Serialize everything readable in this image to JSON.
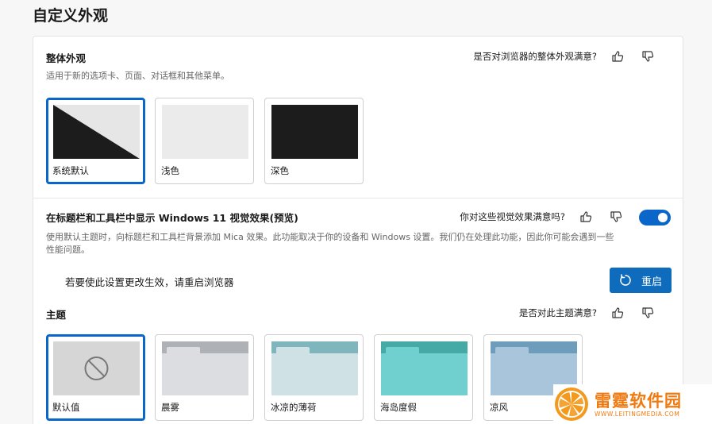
{
  "page": {
    "title": "自定义外观"
  },
  "overall": {
    "title": "整体外观",
    "description": "适用于新的选项卡、页面、对话框和其他菜单。",
    "feedback_question": "是否对浏览器的整体外观满意?",
    "options": [
      {
        "label": "系统默认",
        "selected": true
      },
      {
        "label": "浅色",
        "selected": false
      },
      {
        "label": "深色",
        "selected": false
      }
    ]
  },
  "windows11": {
    "title": "在标题栏和工具栏中显示 Windows 11 视觉效果(预览)",
    "feedback_question": "你对这些视觉效果满意吗?",
    "toggle_on": true,
    "description_line1": "使用默认主题时，向标题栏和工具栏背景添加 Mica 效果。此功能取决于你的设备和 Windows 设置。我们仍在处理此功能，因此你可能会遇到一些",
    "description_line2": "性能问题。",
    "restart_notice": "若要使此设置更改生效，请重启浏览器",
    "restart_button": "重启"
  },
  "theme": {
    "title": "主题",
    "feedback_question": "是否对此主题满意?",
    "options": [
      {
        "label": "默认值",
        "selected": true
      },
      {
        "label": "晨雾",
        "tab_color": "#aeb1b6",
        "body_color": "#dcdde0"
      },
      {
        "label": "冰凉的薄荷",
        "tab_color": "#7fb5bd",
        "body_color": "#cfe1e4"
      },
      {
        "label": "海岛度假",
        "tab_color": "#45a9a6",
        "body_color": "#6fd0cf"
      },
      {
        "label": "凉风",
        "tab_color": "#6e9dbb",
        "body_color": "#a9c5dc"
      }
    ]
  },
  "watermark": {
    "name": "雷霆软件园",
    "url": "WWW.LEITINGMEDIA.COM"
  },
  "colors": {
    "accent": "#0a66c8",
    "button": "#0f6cbd",
    "brand_orange": "#f07a10"
  }
}
